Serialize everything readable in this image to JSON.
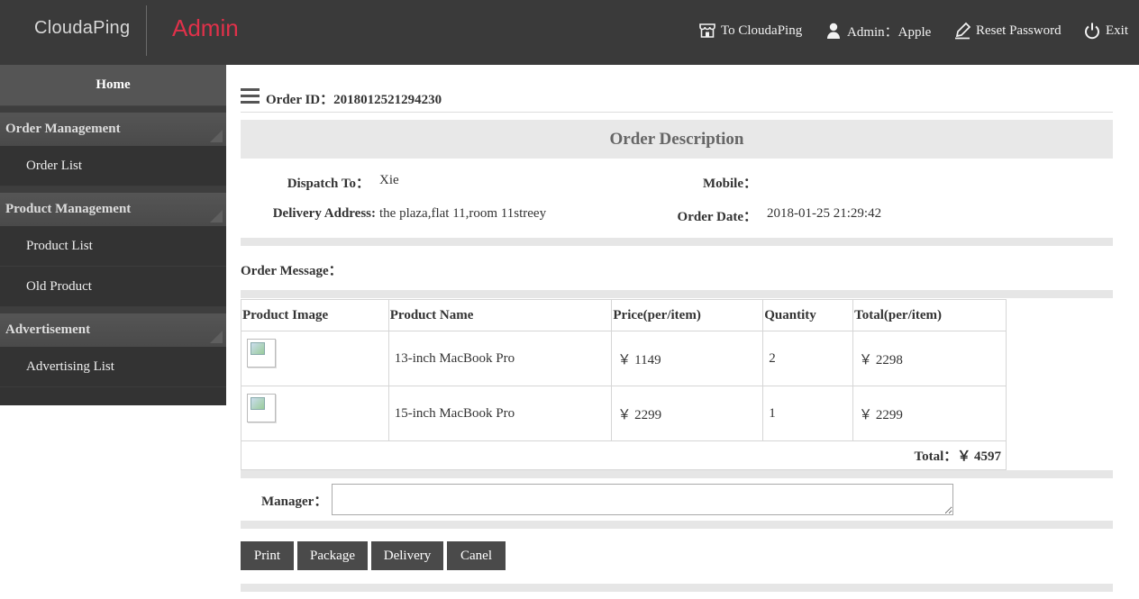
{
  "header": {
    "brand": "CloudaPing",
    "admin_title": "Admin",
    "links": {
      "to_site": "To CloudaPing",
      "admin_user": "Admin：Apple",
      "reset_password": "Reset Password",
      "exit": "Exit"
    },
    "icons": [
      "store-icon",
      "user-icon",
      "pen-icon",
      "power-icon"
    ]
  },
  "sidebar": {
    "home": "Home",
    "groups": [
      {
        "label": "Order Management",
        "items": [
          "Order List"
        ]
      },
      {
        "label": "Product Management",
        "items": [
          "Product List",
          "Old Product"
        ]
      },
      {
        "label": "Advertisement",
        "items": [
          "Advertising List"
        ]
      }
    ]
  },
  "order": {
    "id_label": "Order ID：",
    "id_value": "2018012521294230",
    "section_title": "Order Description",
    "dispatch_label": "Dispatch To：",
    "dispatch_value": "Xie",
    "mobile_label": "Mobile：",
    "mobile_value": "",
    "address_label": "Delivery Address:",
    "address_value": "the plaza,flat 11,room 11streey",
    "date_label": "Order Date：",
    "date_value": "2018-01-25 21:29:42",
    "message_label": "Order Message："
  },
  "table": {
    "headers": [
      "Product Image",
      "Product Name",
      "Price(per/item)",
      "Quantity",
      "Total(per/item)"
    ],
    "rows": [
      {
        "name": "13-inch MacBook Pro",
        "price": "￥ 1149",
        "qty": "2",
        "total": "￥ 2298"
      },
      {
        "name": "15-inch MacBook Pro",
        "price": "￥ 2299",
        "qty": "1",
        "total": "￥ 2299"
      }
    ],
    "total_text": "Total：￥ 4597"
  },
  "manager": {
    "label": "Manager：",
    "value": ""
  },
  "actions": {
    "print": "Print",
    "package": "Package",
    "delivery": "Delivery",
    "cancel": "Canel"
  },
  "colors": {
    "topbar": "#3a3a3a",
    "admin_accent": "#e0314a",
    "sidebar": "#333333",
    "button": "#4a4a4a"
  }
}
